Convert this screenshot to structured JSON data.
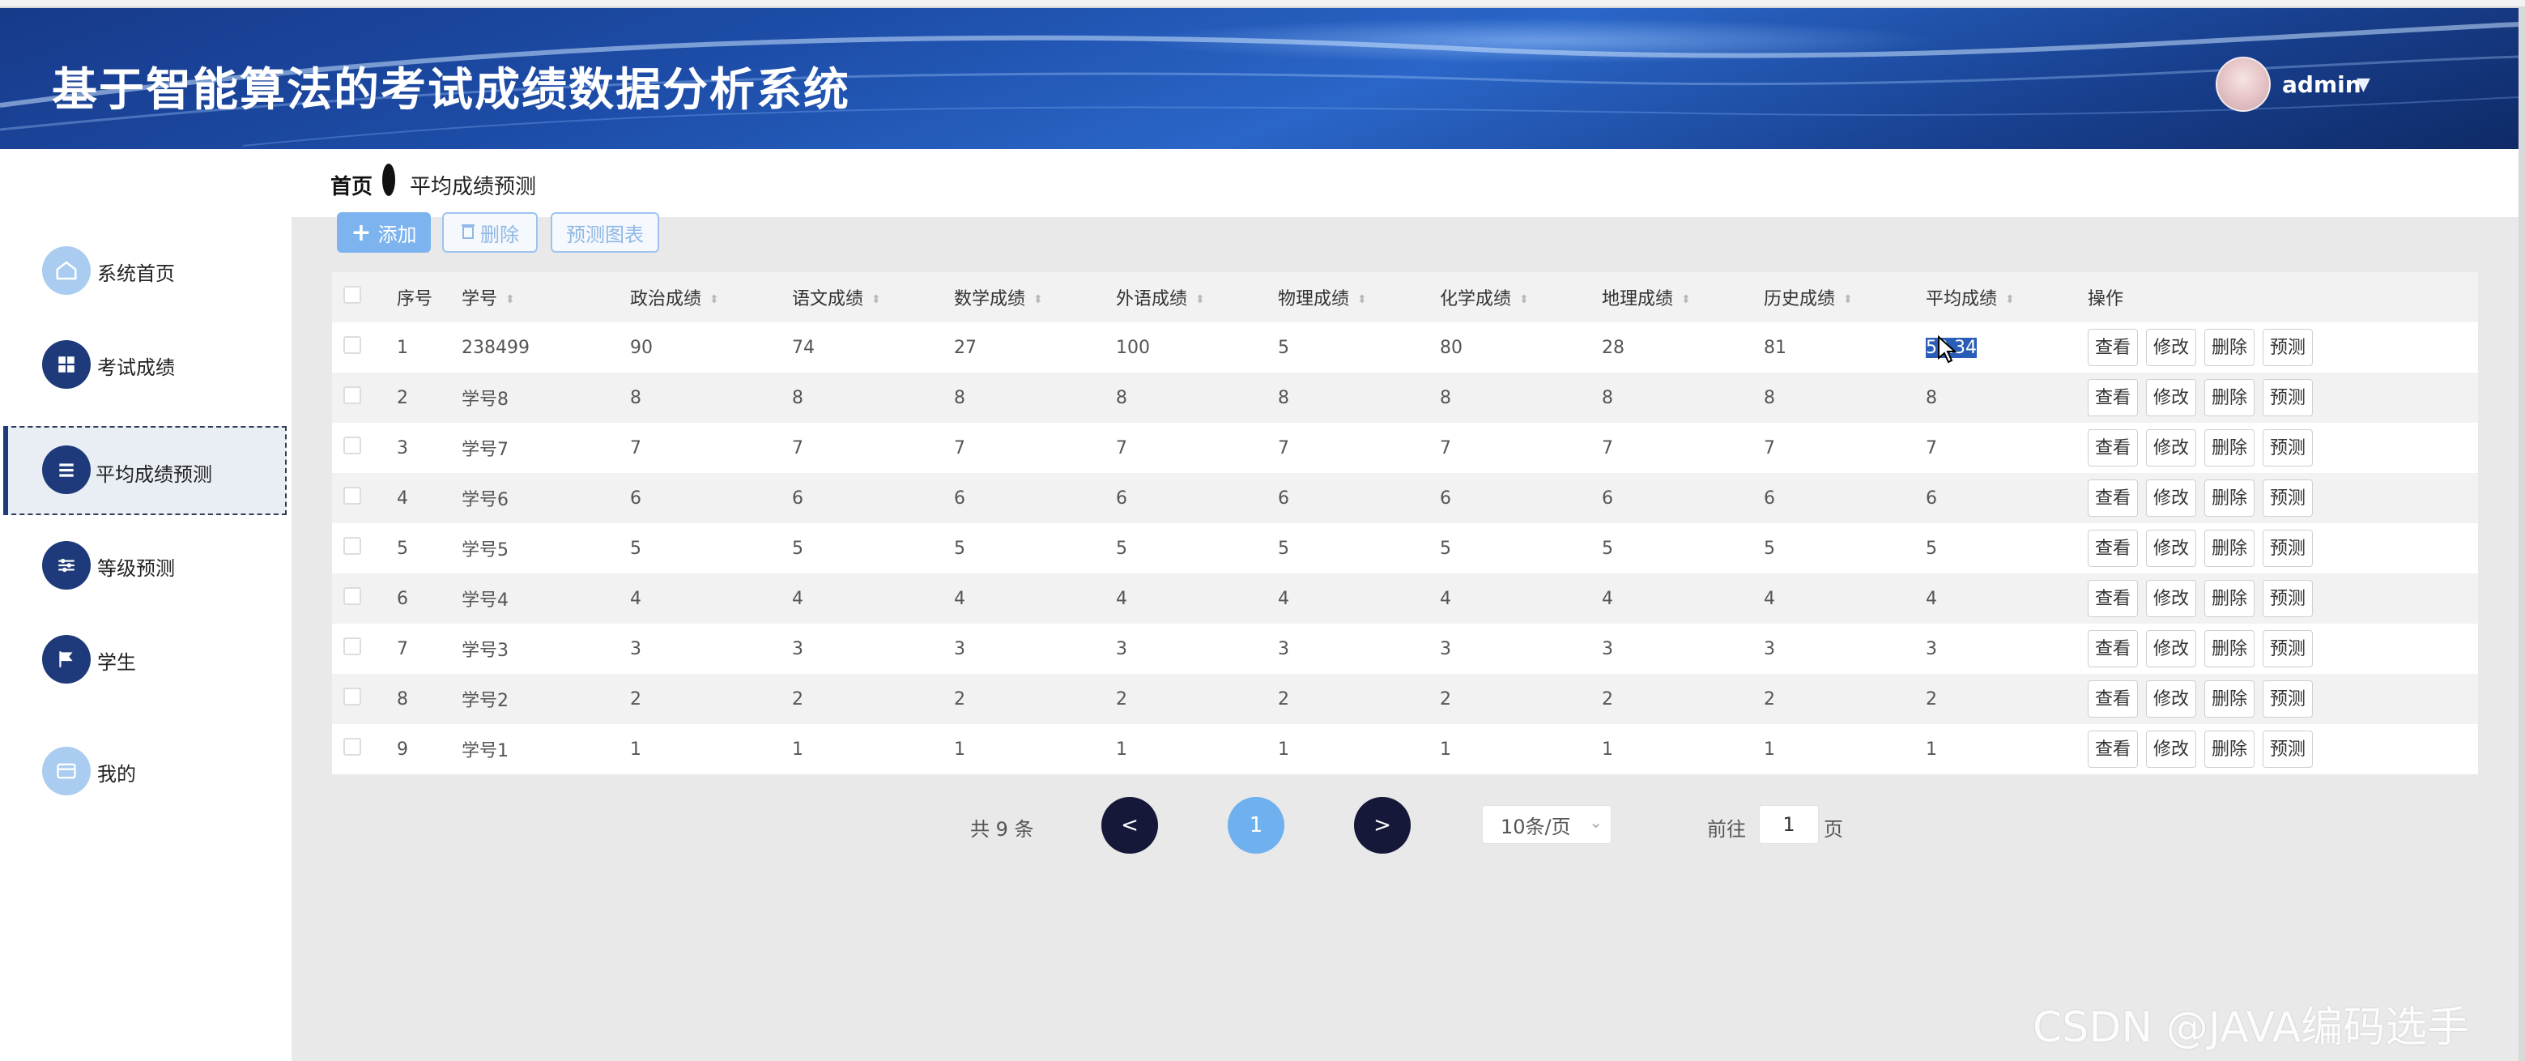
{
  "header": {
    "title": "基于智能算法的考试成绩数据分析系统",
    "user": "admin",
    "caret": "▼"
  },
  "sidebar": {
    "items": [
      {
        "label": "系统首页",
        "icon": "home-icon"
      },
      {
        "label": "考试成绩",
        "icon": "grid-icon"
      },
      {
        "label": "平均成绩预测",
        "icon": "list-icon",
        "active": true
      },
      {
        "label": "等级预测",
        "icon": "sliders-icon"
      },
      {
        "label": "学生",
        "icon": "flag-icon"
      },
      {
        "label": "我的",
        "icon": "card-icon"
      }
    ]
  },
  "breadcrumb": {
    "home": "首页",
    "current": "平均成绩预测"
  },
  "toolbar": {
    "add_label": "添加",
    "delete_label": "删除",
    "chart_label": "预测图表"
  },
  "table": {
    "columns": [
      "序号",
      "学号",
      "政治成绩",
      "语文成绩",
      "数学成绩",
      "外语成绩",
      "物理成绩",
      "化学成绩",
      "地理成绩",
      "历史成绩",
      "平均成绩",
      "操作"
    ],
    "actions": [
      "查看",
      "修改",
      "删除",
      "预测"
    ],
    "rows": [
      [
        "1",
        "238499",
        "90",
        "74",
        "27",
        "100",
        "5",
        "80",
        "28",
        "81",
        "59.34"
      ],
      [
        "2",
        "学号8",
        "8",
        "8",
        "8",
        "8",
        "8",
        "8",
        "8",
        "8",
        "8"
      ],
      [
        "3",
        "学号7",
        "7",
        "7",
        "7",
        "7",
        "7",
        "7",
        "7",
        "7",
        "7"
      ],
      [
        "4",
        "学号6",
        "6",
        "6",
        "6",
        "6",
        "6",
        "6",
        "6",
        "6",
        "6"
      ],
      [
        "5",
        "学号5",
        "5",
        "5",
        "5",
        "5",
        "5",
        "5",
        "5",
        "5",
        "5"
      ],
      [
        "6",
        "学号4",
        "4",
        "4",
        "4",
        "4",
        "4",
        "4",
        "4",
        "4",
        "4"
      ],
      [
        "7",
        "学号3",
        "3",
        "3",
        "3",
        "3",
        "3",
        "3",
        "3",
        "3",
        "3"
      ],
      [
        "8",
        "学号2",
        "2",
        "2",
        "2",
        "2",
        "2",
        "2",
        "2",
        "2",
        "2"
      ],
      [
        "9",
        "学号1",
        "1",
        "1",
        "1",
        "1",
        "1",
        "1",
        "1",
        "1",
        "1"
      ]
    ]
  },
  "pagination": {
    "total": "共 9 条",
    "prev": "<",
    "current": "1",
    "next": ">",
    "page_size": "10条/页",
    "goto_label": "前往",
    "goto_value": "1",
    "goto_suffix": "页"
  },
  "watermark": "CSDN @JAVA编码选手",
  "colors": {
    "header": "#1d4da8",
    "nav_circle": "#1e3a7a",
    "primary_button": "#7db3ee",
    "pager_dark": "#16183a",
    "pager_active": "#6fb0ee"
  }
}
